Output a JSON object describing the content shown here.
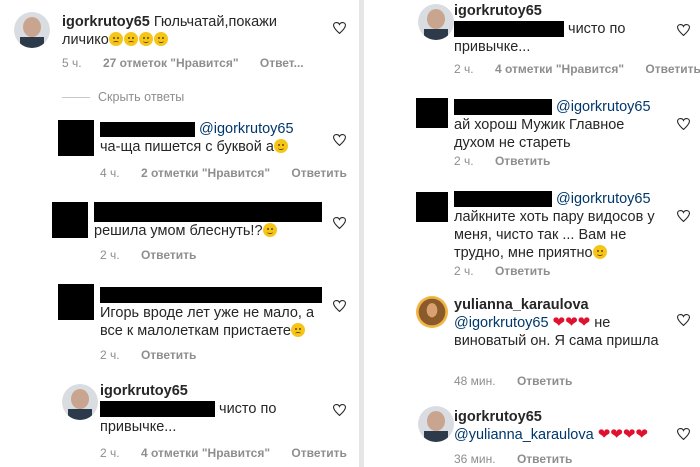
{
  "left": {
    "top_comment": {
      "username": "igorkrutoy65",
      "text": "Гюльчатай,покажи личико",
      "time": "5 ч.",
      "likes": "27 отметок \"Нравится\"",
      "reply": "Ответ..."
    },
    "hide_replies": "Скрыть ответы",
    "replies": [
      {
        "mention": "@igorkrutoy65",
        "text": "ча-ща пишется с буквой а",
        "time": "4 ч.",
        "likes": "2 отметки \"Нравится\"",
        "reply": "Ответить"
      },
      {
        "text": "решила умом блеснуть!?",
        "time": "2 ч.",
        "reply": "Ответить"
      },
      {
        "text": "Игорь вроде лет уже не мало, а все к малолеткам пристаете",
        "time": "2 ч.",
        "reply": "Ответить"
      },
      {
        "username": "igorkrutoy65",
        "text": "чисто по привычке...",
        "time": "2 ч.",
        "likes": "4 отметки \"Нравится\"",
        "reply": "Ответить"
      }
    ]
  },
  "right": {
    "comments": [
      {
        "username": "igorkrutoy65",
        "text": "чисто по привычке...",
        "time": "2 ч.",
        "likes": "4 отметки \"Нравится\"",
        "reply": "Ответить"
      },
      {
        "mention": "@igorkrutoy65",
        "text": "ай хорош Мужик Главное духом не стареть",
        "time": "2 ч.",
        "reply": "Ответить"
      },
      {
        "mention": "@igorkrutoy65",
        "text": "лайкните хоть пару видосов у меня, чисто так ... Вам не трудно, мне приятно",
        "time": "2 ч.",
        "reply": "Ответить"
      },
      {
        "username": "yulianna_karaulova",
        "mention": "@igorkrutoy65",
        "text": "не виноватый он. Я сама пришла",
        "time": "48 мин.",
        "reply": "Ответить"
      },
      {
        "username": "igorkrutoy65",
        "mention": "@yulianna_karaulova",
        "time": "36 мин.",
        "reply": "Ответить"
      }
    ]
  },
  "colors": {
    "text": "#262626",
    "meta": "#8e8e8e",
    "mention": "#00376b",
    "heart_emoji": "#e0102f"
  }
}
